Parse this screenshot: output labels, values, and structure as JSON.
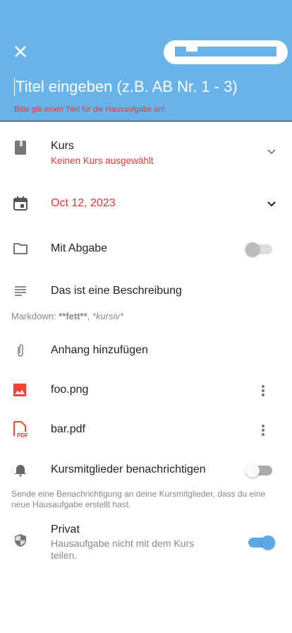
{
  "header": {
    "title_placeholder": "Titel eingeben (z.B. AB Nr. 1 - 3)",
    "error": "Bitte gib einen Titel für die Hausaufgabe an!",
    "close_icon": "close-icon",
    "save_button_color": "#ffffff",
    "accent": "#68b3ea"
  },
  "course": {
    "label": "Kurs",
    "value": "Keinen Kurs ausgewählt"
  },
  "date": {
    "value": "Oct 12, 2023"
  },
  "submission": {
    "label": "Mit Abgabe",
    "enabled": false
  },
  "description": {
    "value": "Das ist eine Beschreibung",
    "hint_prefix": "Markdown: ",
    "hint_bold": "**fett**",
    "hint_sep": ", ",
    "hint_italic": "*kursiv*"
  },
  "attachments": {
    "add_label": "Anhang hinzufügen",
    "files": [
      {
        "name": "foo.png",
        "icon": "image-icon"
      },
      {
        "name": "bar.pdf",
        "icon": "pdf-icon"
      }
    ]
  },
  "notify": {
    "label": "Kursmitglieder benachrichtigen",
    "enabled": false,
    "hint": "Sende eine Benachrichtigung an deine Kursmitglieder, dass du eine neue Hausaufgabe erstellt hast."
  },
  "private": {
    "label": "Privat",
    "sub": "Hausaufgabe nicht mit dem Kurs teilen.",
    "enabled": true
  },
  "colors": {
    "error": "#e53935",
    "toggle_on": "#5aa8e8"
  }
}
